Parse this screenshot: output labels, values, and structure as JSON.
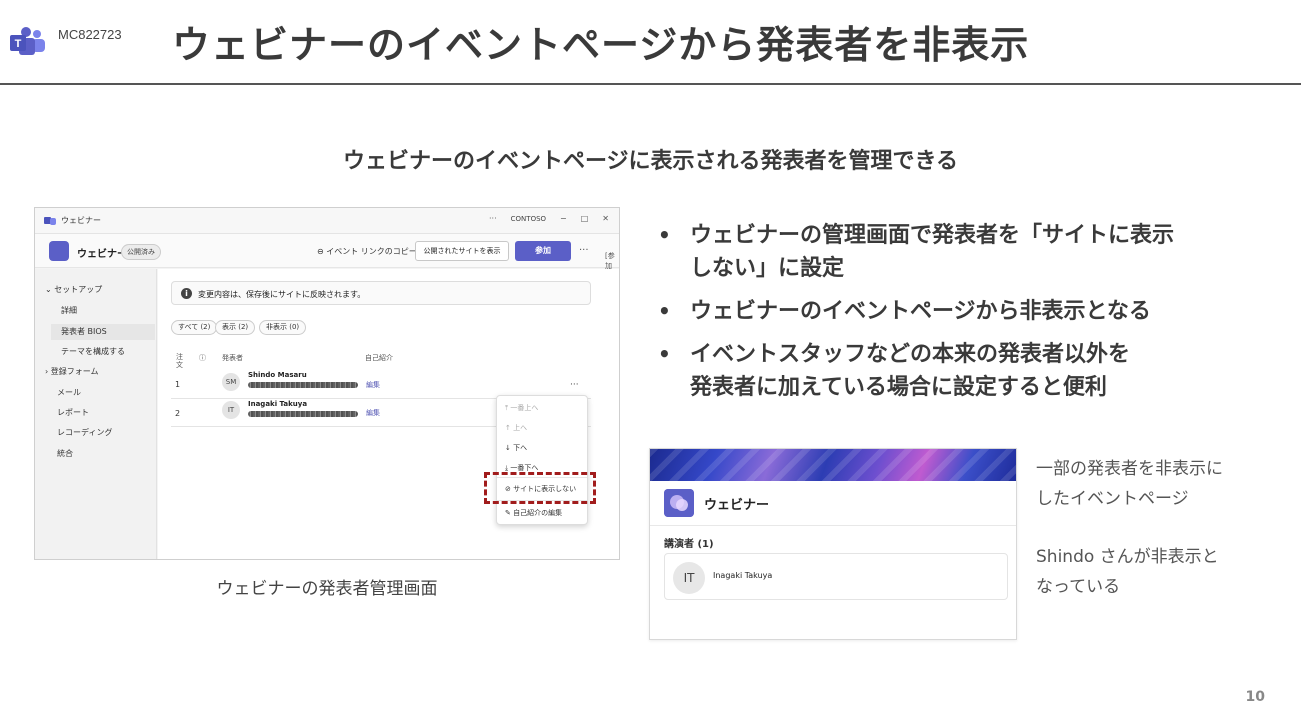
{
  "header": {
    "mc_id": "MC822723",
    "title": "ウェビナーのイベントページから発表者を非表示"
  },
  "subtitle": "ウェビナーのイベントページに表示される発表者を管理できる",
  "screenshot": {
    "window_title": "ウェビナー",
    "window_org": "CONTOSO",
    "window_controls": [
      "···",
      "−",
      "□",
      "✕"
    ],
    "app_name": "ウェビナー",
    "app_badge": "公開済み",
    "copy_link": "イベント リンクのコピー",
    "btn_public": "公開されたサイトを表示",
    "btn_join": "参加",
    "more": "···",
    "edge_text": "[参加",
    "sidebar": [
      {
        "label": "セットアップ",
        "icon": "chevron-down-icon"
      },
      {
        "label": "詳細"
      },
      {
        "label": "発表者 BIOS",
        "active": true
      },
      {
        "label": "テーマを構成する"
      },
      {
        "label": "登録フォーム",
        "icon": "chevron-right-icon"
      },
      {
        "label": "メール"
      },
      {
        "label": "レポート"
      },
      {
        "label": "レコーディング"
      },
      {
        "label": "統合"
      }
    ],
    "notice": "変更内容は、保存後にサイトに反映されます。",
    "filters": [
      "すべて (2)",
      "表示 (2)",
      "非表示 (0)"
    ],
    "table_headers": [
      "注文",
      "ⓘ",
      "発表者",
      "自己紹介"
    ],
    "rows": [
      {
        "order": "1",
        "initials": "SM",
        "name": "Shindo Masaru",
        "edit": "編集"
      },
      {
        "order": "2",
        "initials": "IT",
        "name": "Inagaki Takuya",
        "edit": "編集"
      }
    ],
    "menu": [
      {
        "label": "一番上へ",
        "icon": "arrow-top-icon",
        "disabled": true
      },
      {
        "label": "上へ",
        "icon": "arrow-up-icon",
        "disabled": true
      },
      {
        "label": "下へ",
        "icon": "arrow-down-icon",
        "disabled": false
      },
      {
        "label": "一番下へ",
        "icon": "arrow-bottom-icon",
        "disabled": false
      },
      {
        "label": "サイトに表示しない",
        "icon": "eye-off-icon",
        "disabled": false
      },
      {
        "label": "自己紹介の編集",
        "icon": "pencil-icon",
        "disabled": false
      }
    ]
  },
  "caption_left": "ウェビナーの発表者管理画面",
  "bullets": [
    "ウェビナーの管理画面で発表者を「サイトに表示しない」に設定",
    "ウェビナーのイベントページから非表示となる",
    "イベントスタッフなどの本来の発表者以外を発表者に加えている場合に設定すると便利"
  ],
  "bullet_lines": [
    [
      "ウェビナーの管理画面で発表者を「サイトに表示",
      "しない」に設定"
    ],
    [
      "ウェビナーのイベントページから非表示となる"
    ],
    [
      "イベントスタッフなどの本来の発表者以外を",
      "発表者に加えている場合に設定すると便利"
    ]
  ],
  "event_card": {
    "title": "ウェビナー",
    "section": "講演者 (1)",
    "speaker_initials": "IT",
    "speaker_name": "Inagaki Takuya"
  },
  "note_lines": [
    [
      "一部の発表者を非表示に",
      "したイベントページ"
    ],
    [
      "Shindo さんが非表示と",
      "なっている"
    ]
  ],
  "page_number": "10",
  "colors": {
    "accent": "#5b5fc7",
    "highlight": "#a11c1c",
    "title_text": "#3a3a3a"
  }
}
